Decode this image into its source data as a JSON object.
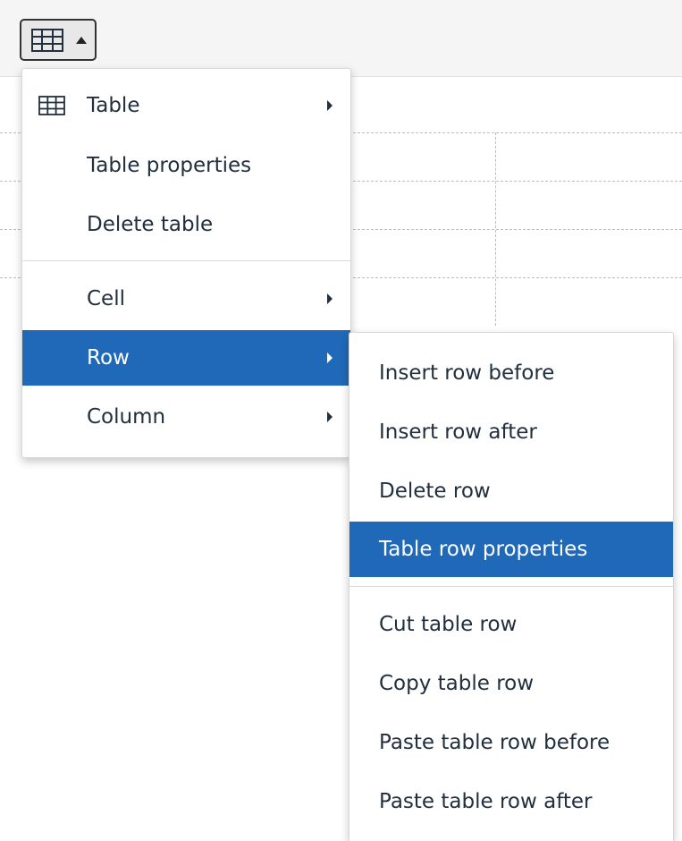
{
  "toolbar": {
    "table_button_icon": "table-icon",
    "table_button_caret": "caret-up-icon"
  },
  "main_menu": {
    "items": [
      {
        "label": "Table",
        "icon": "table-icon",
        "has_submenu": true
      },
      {
        "label": "Table properties"
      },
      {
        "label": "Delete table"
      },
      {
        "label": "Cell",
        "has_submenu": true
      },
      {
        "label": "Row",
        "has_submenu": true,
        "active": true
      },
      {
        "label": "Column",
        "has_submenu": true
      }
    ]
  },
  "row_submenu": {
    "items": [
      {
        "label": "Insert row before"
      },
      {
        "label": "Insert row after"
      },
      {
        "label": "Delete row"
      },
      {
        "label": "Table row properties",
        "active": true
      },
      {
        "label": "Cut table row"
      },
      {
        "label": "Copy table row"
      },
      {
        "label": "Paste table row before"
      },
      {
        "label": "Paste table row after"
      }
    ]
  },
  "colors": {
    "accent": "#2069b8",
    "text": "#222f3e",
    "toolbar_bg": "#f5f5f5"
  }
}
